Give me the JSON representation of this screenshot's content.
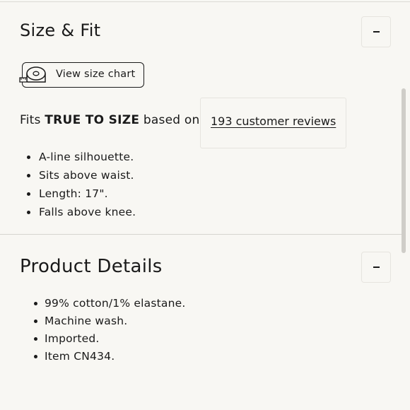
{
  "size_fit": {
    "title": "Size & Fit",
    "toggle_label": "-",
    "size_chart_label": "View size chart",
    "fit_prefix": "Fits",
    "fit_emphasis": "TRUE TO SIZE",
    "fit_suffix": "based on",
    "reviews_link": "193 customer reviews",
    "bullets": [
      "A-line silhouette.",
      "Sits above waist.",
      "Length: 17\".",
      "Falls above knee."
    ]
  },
  "product_details": {
    "title": "Product Details",
    "toggle_label": "-",
    "bullets": [
      "99% cotton/1% elastane.",
      "Machine wash.",
      "Imported.",
      "Item CN434."
    ]
  },
  "icons": {
    "size_chart": "measuring-tape-icon",
    "collapse": "minus-icon"
  }
}
